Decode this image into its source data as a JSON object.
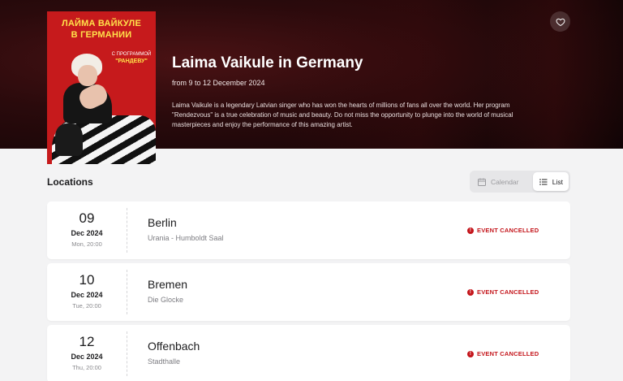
{
  "event": {
    "poster": {
      "title_line1": "ЛАЙМА ВАЙКУЛЕ",
      "title_line2": "В ГЕРМАНИИ",
      "program_label": "С ПРОГРАММОЙ",
      "program_name": "\"РАНДЕВУ\""
    },
    "title": "Laima Vaikule in Germany",
    "dates": "from 9 to 12 December 2024",
    "description": "Laima Vaikule is a legendary Latvian singer who has won the hearts of millions of fans all over the world. Her program \"Rendezvous\" is a true celebration of music and beauty. Do not miss the opportunity to plunge into the world of musical masterpieces and enjoy the performance of this amazing artist.",
    "favorite_icon": "heart-icon"
  },
  "locations": {
    "title": "Locations",
    "view_switch": {
      "calendar_label": "Calendar",
      "list_label": "List",
      "active": "list"
    },
    "items": [
      {
        "day": "09",
        "month_year": "Dec 2024",
        "weekday_time": "Mon, 20:00",
        "city": "Berlin",
        "venue": "Urania - Humboldt Saal",
        "status": "EVENT CANCELLED"
      },
      {
        "day": "10",
        "month_year": "Dec 2024",
        "weekday_time": "Tue, 20:00",
        "city": "Bremen",
        "venue": "Die Glocke",
        "status": "EVENT CANCELLED"
      },
      {
        "day": "12",
        "month_year": "Dec 2024",
        "weekday_time": "Thu, 20:00",
        "city": "Offenbach",
        "venue": "Stadthalle",
        "status": "EVENT CANCELLED"
      }
    ]
  },
  "colors": {
    "hero_bg": "#2a0a0c",
    "status_cancelled": "#c4151b",
    "poster_red": "#c61a1c",
    "poster_yellow": "#ffe14a"
  }
}
